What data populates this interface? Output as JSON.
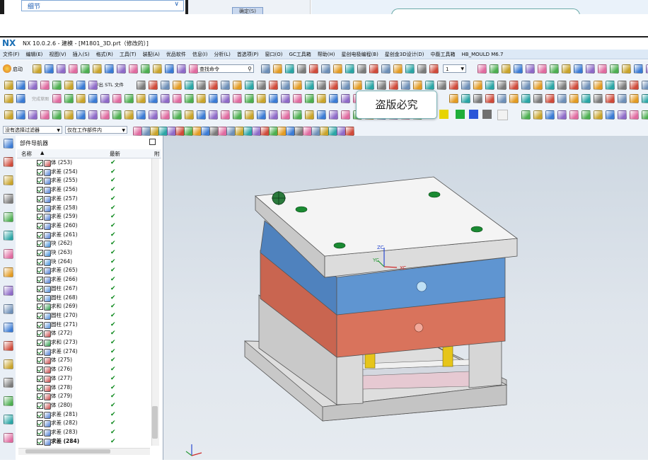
{
  "top_strip": {
    "combo_value": "细节",
    "button_label": "确定(S)"
  },
  "title": {
    "logo": "NX",
    "text": "NX 10.0.2.6 - 建模 - [M1801_3D.prt（修改的）]"
  },
  "menu": [
    "文件(F)",
    "编辑(E)",
    "视图(V)",
    "插入(S)",
    "格式(R)",
    "工具(T)",
    "装配(A)",
    "优品软件",
    "信息(I)",
    "分析(L)",
    "首选项(P)",
    "窗口(O)",
    "GC工具箱",
    "帮助(H)",
    "星创电极编程(B)",
    "星创金3D设计(D)",
    "中磊工具箱",
    "HB_MOULD M6.7"
  ],
  "toolbar": {
    "start_label": "启动",
    "search_placeholder": "查找命令",
    "zoom_value": "1",
    "export_stl_label": "导出 STL 文件",
    "complete_sketch_label": "完成草图"
  },
  "tooltip": "盗版必究",
  "selection_bar": {
    "filter_value": "没有选择过滤器",
    "scope_value": "仅在工作部件内"
  },
  "navigator": {
    "title": "部件导航器",
    "col_name": "名称",
    "col_latest": "最新",
    "col_extra": "附",
    "rows": [
      {
        "label": "体 (253)",
        "type": "body",
        "bold": false
      },
      {
        "label": "求差 (254)",
        "type": "subtract",
        "bold": false
      },
      {
        "label": "求差 (255)",
        "type": "subtract",
        "bold": false
      },
      {
        "label": "求差 (256)",
        "type": "subtract",
        "bold": false
      },
      {
        "label": "求差 (257)",
        "type": "subtract",
        "bold": false
      },
      {
        "label": "求差 (258)",
        "type": "subtract",
        "bold": false
      },
      {
        "label": "求差 (259)",
        "type": "subtract",
        "bold": false
      },
      {
        "label": "求差 (260)",
        "type": "subtract",
        "bold": false
      },
      {
        "label": "求差 (261)",
        "type": "subtract",
        "bold": false
      },
      {
        "label": "块 (262)",
        "type": "block",
        "bold": false
      },
      {
        "label": "块 (263)",
        "type": "block",
        "bold": false
      },
      {
        "label": "块 (264)",
        "type": "block",
        "bold": false
      },
      {
        "label": "求差 (265)",
        "type": "subtract",
        "bold": false
      },
      {
        "label": "求差 (266)",
        "type": "subtract",
        "bold": false
      },
      {
        "label": "圆柱 (267)",
        "type": "cylinder",
        "bold": false
      },
      {
        "label": "圆柱 (268)",
        "type": "cylinder",
        "bold": false
      },
      {
        "label": "求和 (269)",
        "type": "unite",
        "bold": false
      },
      {
        "label": "圆柱 (270)",
        "type": "cylinder",
        "bold": false
      },
      {
        "label": "圆柱 (271)",
        "type": "cylinder",
        "bold": false
      },
      {
        "label": "体 (272)",
        "type": "body",
        "bold": false
      },
      {
        "label": "求和 (273)",
        "type": "unite",
        "bold": false
      },
      {
        "label": "求差 (274)",
        "type": "subtract",
        "bold": false
      },
      {
        "label": "体 (275)",
        "type": "body",
        "bold": false
      },
      {
        "label": "体 (276)",
        "type": "body",
        "bold": false
      },
      {
        "label": "体 (277)",
        "type": "body",
        "bold": false
      },
      {
        "label": "体 (278)",
        "type": "body",
        "bold": false
      },
      {
        "label": "体 (279)",
        "type": "body",
        "bold": false
      },
      {
        "label": "体 (280)",
        "type": "body",
        "bold": false
      },
      {
        "label": "求差 (281)",
        "type": "subtract",
        "bold": false
      },
      {
        "label": "求差 (282)",
        "type": "subtract",
        "bold": false
      },
      {
        "label": "求差 (283)",
        "type": "subtract",
        "bold": false
      },
      {
        "label": "求差 (284)",
        "type": "subtract",
        "bold": true
      }
    ]
  },
  "viewport": {
    "axis_zc": "ZC",
    "axis_yc": "YC",
    "axis_xc": "XC"
  },
  "colors": {
    "plate_blue": "#5f95d1",
    "plate_red": "#d9735c",
    "plate_grey": "#d2d2d2",
    "pin_yellow": "#e6c51a",
    "check_green": "#0e8a1e"
  }
}
